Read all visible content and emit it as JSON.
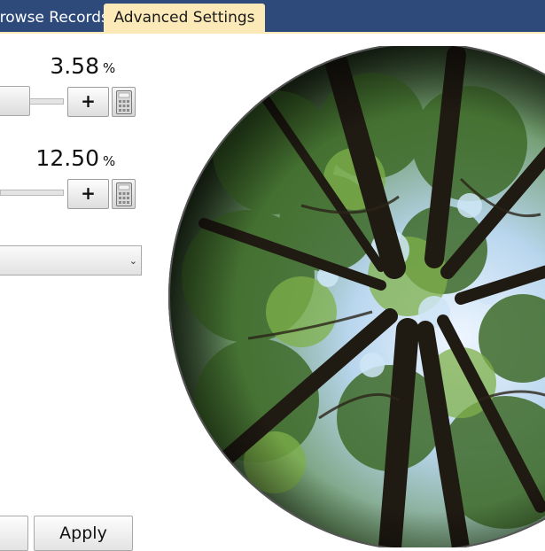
{
  "tabs": {
    "browse_label": "Browse Records",
    "advanced_label": "Advanced Settings"
  },
  "setting1": {
    "value": "3.58",
    "unit": "%",
    "plus_label": "+"
  },
  "setting2": {
    "value": "12.50",
    "unit": "%",
    "plus_label": "+"
  },
  "dropdown": {
    "selected": "",
    "arrow": "⌄"
  },
  "buttons": {
    "apply_label": "Apply"
  },
  "colors": {
    "tabbar": "#2d4a7a",
    "active_tab": "#fbe9b8"
  },
  "icons": {
    "calculator": "calculator-icon",
    "dropdown": "chevron-down-icon"
  },
  "image": {
    "subject": "hemispherical fisheye photo of forest canopy"
  }
}
